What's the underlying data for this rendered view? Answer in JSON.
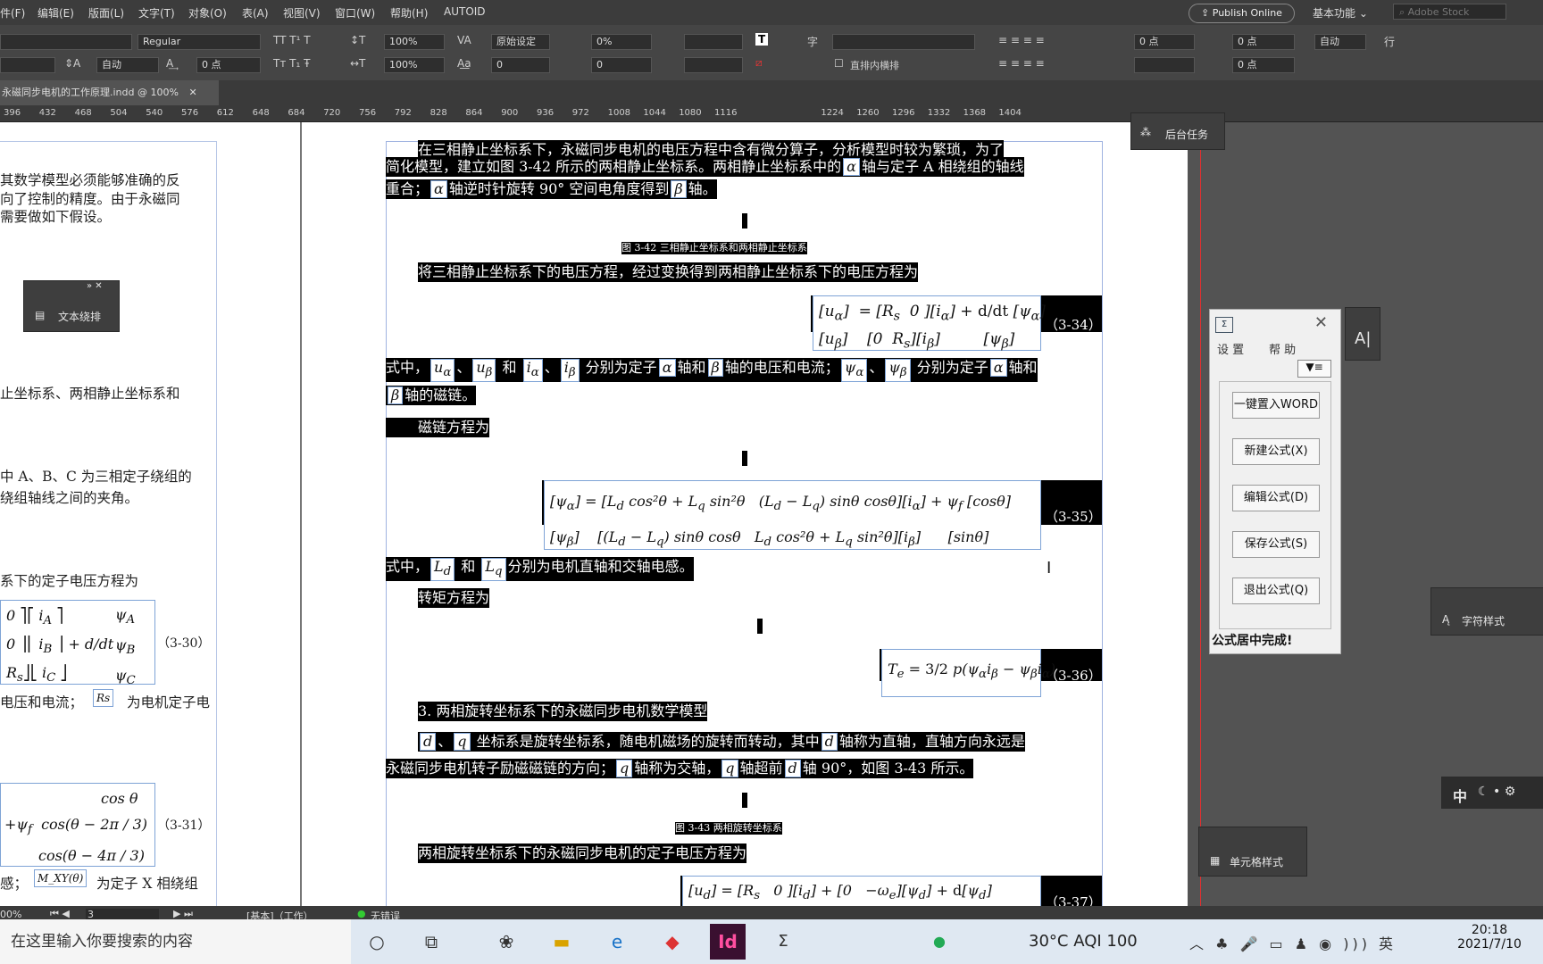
{
  "menubar": {
    "items": [
      "件(F)",
      "编辑(E)",
      "版面(L)",
      "文字(T)",
      "对象(O)",
      "表(A)",
      "视图(V)",
      "窗口(W)",
      "帮助(H)",
      "AUTOID"
    ],
    "publish_label": "Publish Online",
    "workspace_label": "基本功能",
    "stock_placeholder": "Adobe Stock"
  },
  "control": {
    "font_style": "Regular",
    "leading": "自动",
    "tracking_pt": "0 点",
    "vscale": "100%",
    "hscale": "100%",
    "kerning": "原始设定",
    "tracking": "0%",
    "baseline": "0",
    "skew": "0",
    "indent_left": "0 点",
    "indent_right": "0 点",
    "space_before": "0 点",
    "space_after": "0 点",
    "grid_leading": "自动",
    "row_label": "行",
    "vertical_option": "直排内横排",
    "char_label": "字"
  },
  "document": {
    "tab_title": "永磁同步电机的工作原理.indd @ 100%",
    "ruler_ticks": [
      "396",
      "432",
      "468",
      "504",
      "540",
      "576",
      "612",
      "648",
      "684",
      "720",
      "756",
      "792",
      "828",
      "864",
      "900",
      "936",
      "972",
      "1008",
      "1044",
      "1080",
      "1116",
      "1224",
      "1260",
      "1296",
      "1332",
      "1368",
      "1404"
    ]
  },
  "left_page": {
    "lines": [
      "其数学模型必须能够准确的反",
      "向了控制的精度。由于永磁同",
      "需要做如下假设。",
      "止坐标系、两相静止坐标系和",
      "中 A、B、C 为三相定子绕组的",
      "绕组轴线之间的夹角。",
      "系下的定子电压方程为",
      "电压和电流；",
      "为电机定子电",
      "感；",
      "为定子 X 相绕组"
    ],
    "eq_3_30": "（3-30）",
    "eq_3_31": "（3-31）",
    "rs_symbol": "Rs",
    "mxy_symbol": "M_XY(θ)"
  },
  "right_page": {
    "para1_line1": "在三相静止坐标系下，永磁同步电机的电压方程中含有微分算子，分析模型时较为繁琐，为了",
    "para1_line2": "简化模型，建立如图 3-42 所示的两相静止坐标系。两相静止坐标系中的",
    "para1_line2b": "轴与定子 A 相绕组的轴线",
    "para1_line3a": "重合；",
    "para1_line3b": "轴逆时针旋转 90° 空间电角度得到",
    "para1_line3c": "轴。",
    "alpha": "α",
    "beta": "β",
    "fig_3_42": "图 3-42 三相静止坐标系和两相静止坐标系",
    "para2": "将三相静止坐标系下的电压方程，经过变换得到两相静止坐标系下的电压方程为",
    "eq_3_34": "（3-34）",
    "para3_a": "式中，",
    "para3_b": "分别为定子",
    "para3_c": "轴和",
    "para3_d": "轴的电压和电流；",
    "para3_e": "分别为定子",
    "para3_f": "轴和",
    "para3_g": "轴的磁链。",
    "para4": "磁链方程为",
    "eq_3_35": "（3-35）",
    "para5_a": "式中，",
    "para5_b": "和",
    "para5_c": "分别为电机直轴和交轴电感。",
    "para6": "转矩方程为",
    "eq_3_36": "（3-36）",
    "heading3": "3. 两相旋转坐标系下的永磁同步电机数学模型",
    "para7_line1a": "坐标系是旋转坐标系，随电机磁场的旋转而转动，其中",
    "para7_line1b": "轴称为直轴，直轴方向永远是",
    "para7_line2a": "永磁同步电机转子励磁磁链的方向；",
    "para7_line2b": "轴称为交轴，",
    "para7_line2c": "轴超前",
    "para7_line2d": "轴 90°，如图 3-43 所示。",
    "fig_3_43": "图 3-43 两相旋转坐标系",
    "para8": "两相旋转坐标系下的永磁同步电机的定子电压方程为",
    "eq_3_37": "（3-37）"
  },
  "panels": {
    "text_wrap": "文本绕排",
    "bg_tasks": "后台任务",
    "char_styles": "字符样式",
    "cell_styles": "单元格样式"
  },
  "formula_tool": {
    "menu_settings": "设 置",
    "menu_help": "帮 助",
    "buttons": [
      "一键置入WORD",
      "新建公式(X)",
      "编辑公式(D)",
      "保存公式(S)",
      "退出公式(Q)"
    ],
    "status": "公式居中完成!"
  },
  "statusbar": {
    "zoom": "00%",
    "page": "3",
    "style": "[基本]（工作）",
    "errors": "无错误"
  },
  "taskbar": {
    "search_placeholder": "在这里输入你要搜索的内容",
    "weather": "30°C  AQI 100",
    "time": "20:18",
    "date": "2021/7/10",
    "ime_label": "中"
  }
}
